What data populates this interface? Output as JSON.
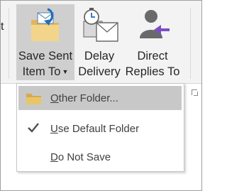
{
  "ribbon": {
    "partial_label": "t",
    "buttons": [
      {
        "line1": "Save Sent",
        "line2": "Item To",
        "icon": "save-sent-folder-icon",
        "has_dropdown": true
      },
      {
        "line1": "Delay",
        "line2": "Delivery",
        "icon": "delay-delivery-icon",
        "has_dropdown": false
      },
      {
        "line1": "Direct",
        "line2": "Replies To",
        "icon": "direct-replies-icon",
        "has_dropdown": false
      }
    ]
  },
  "menu": {
    "items": [
      {
        "mnemonic": "O",
        "rest": "ther Folder...",
        "icon": "folder-icon",
        "checked": false,
        "highlighted": true
      },
      {
        "mnemonic": "U",
        "rest": "se Default Folder",
        "icon": "checkmark-icon",
        "checked": true,
        "highlighted": false
      },
      {
        "mnemonic": "D",
        "rest": "o Not Save",
        "icon": "",
        "checked": false,
        "highlighted": false
      }
    ]
  },
  "colors": {
    "ribbon_bg": "#f3f3f3",
    "selected_button_bg": "#cfcfcf",
    "menu_highlight_bg": "#c8c8c8",
    "folder_yellow": "#e8c56a",
    "accent_blue": "#1e6fb8",
    "accent_purple": "#7a4fc2"
  }
}
